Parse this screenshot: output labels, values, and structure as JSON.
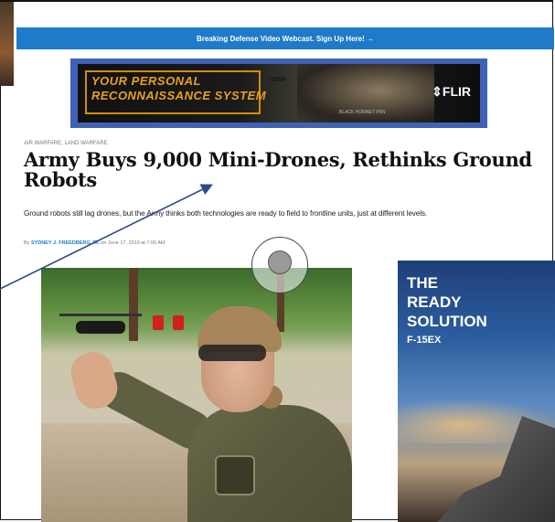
{
  "banner": {
    "text": "Breaking Defense Video Webcast. Sign Up Here! →"
  },
  "ad_top": {
    "headline_line1": "YOUR PERSONAL",
    "headline_line2": "RECONNAISSANCE SYSTEM",
    "brand": "⇕FLIR",
    "product": "BLACK HORNET PRS",
    "accent_color": "#e8a020",
    "frame_color": "#3f62b4"
  },
  "article": {
    "category": "AIR WARFARE, LAND WARFARE",
    "title": "Army Buys 9,000 Mini-Drones, Rethinks Ground Robots",
    "subtitle": "Ground robots still lag drones, but the Army thinks both technologies are ready to field to frontline units, just at different levels.",
    "byline_prefix": "By",
    "author": "SYDNEY J. FREEDBERG JR.",
    "date": "on June 17, 2019 at 7:00 AM"
  },
  "ad_side": {
    "line1": "THE",
    "line2": "READY",
    "line3": "SOLUTION",
    "product": "F-15EX"
  },
  "colors": {
    "banner": "#1f7bc9",
    "author_link": "#1f7bc9",
    "annotation_arrow": "#2b4a8c"
  },
  "icons": {
    "banner_arrow": "arrow-right-icon",
    "cursor": "cursor-ring-icon"
  }
}
